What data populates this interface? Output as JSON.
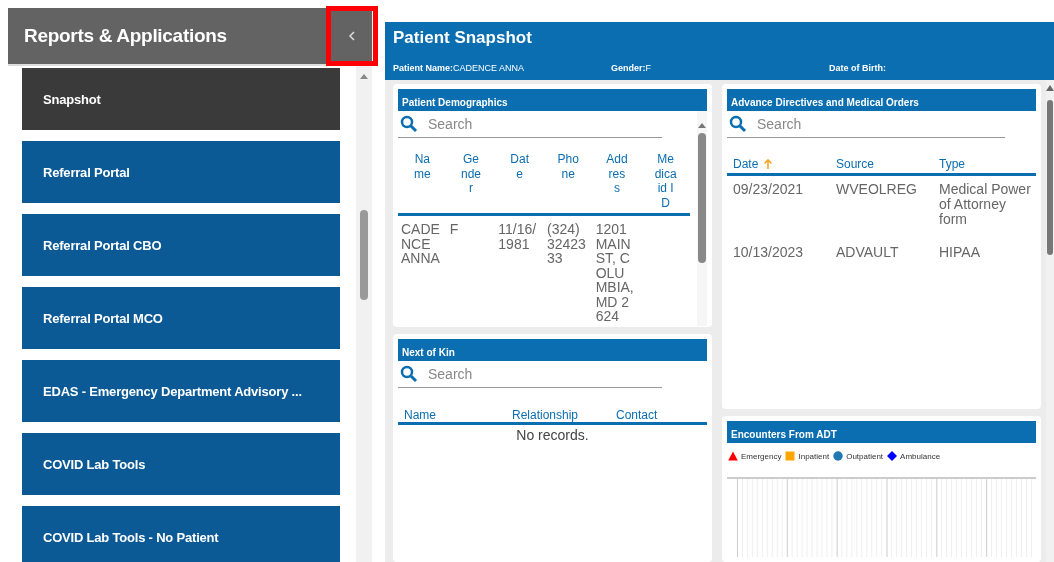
{
  "sidebar": {
    "title": "Reports & Applications",
    "items": [
      {
        "label": "Snapshot",
        "selected": true
      },
      {
        "label": "Referral Portal",
        "selected": false
      },
      {
        "label": "Referral Portal CBO",
        "selected": false
      },
      {
        "label": "Referral Portal MCO",
        "selected": false
      },
      {
        "label": "EDAS - Emergency Department Advisory ...",
        "selected": false
      },
      {
        "label": "COVID Lab Tools",
        "selected": false
      },
      {
        "label": "COVID Lab Tools - No Patient",
        "selected": false
      }
    ]
  },
  "main": {
    "title": "Patient Snapshot",
    "patient_info": [
      {
        "label": "Patient Name:",
        "value": "CADENCE ANNA"
      },
      {
        "label": "Gender:",
        "value": "F"
      },
      {
        "label": "Date of Birth:"
      }
    ],
    "demographics": {
      "title": "Patient Demographics",
      "search": {
        "placeholder": "Search"
      },
      "columns": [
        "Name",
        "Gender",
        "Date",
        "Phone",
        "Address",
        "Medicaid ID"
      ],
      "rows": [
        [
          "CADENCE ANNA",
          "F",
          "11/16/1981",
          "(324) 3242333",
          "1201 MAIN ST, COLUMBIA, MD 2624",
          ""
        ]
      ]
    },
    "next_of_kin": {
      "title": "Next of Kin",
      "search": {
        "placeholder": "Search"
      },
      "columns": [
        "Name",
        "Relationship",
        "Contact"
      ],
      "empty_text": "No records."
    },
    "directives": {
      "title": "Advance Directives and Medical Orders",
      "search": {
        "placeholder": "Search"
      },
      "columns": [
        {
          "label": "Date",
          "sorted": true
        },
        {
          "label": "Source",
          "sorted": false
        },
        {
          "label": "Type",
          "sorted": false
        }
      ],
      "rows": [
        [
          "09/23/2021",
          "WVEOLREG",
          "Medical Power of Attorney form"
        ],
        [
          "10/13/2023",
          "ADVAULT",
          "HIPAA"
        ]
      ]
    },
    "encounters": {
      "title": "Encounters From ADT",
      "legend": [
        {
          "label": "Emergency",
          "kind": "triangle",
          "color": "#ff0000"
        },
        {
          "label": "Inpatient",
          "kind": "square",
          "color": "#ffa500"
        },
        {
          "label": "Outpatient",
          "kind": "circle",
          "color": "#1f77b4"
        },
        {
          "label": "Ambulance",
          "kind": "diamond",
          "color": "#0000ff"
        }
      ]
    }
  }
}
